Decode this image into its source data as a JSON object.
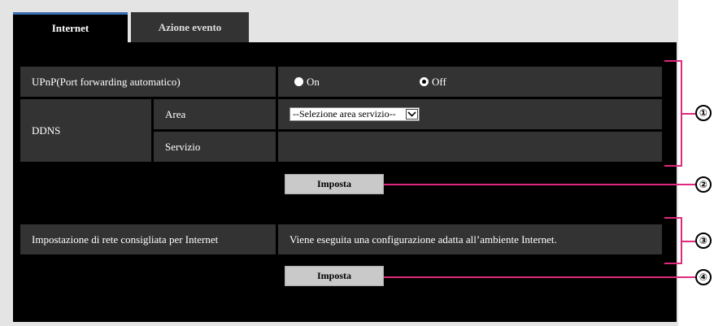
{
  "tabs": [
    {
      "label": "Internet"
    },
    {
      "label": "Azione evento"
    }
  ],
  "upnp": {
    "label": "UPnP(Port forwarding automatico)",
    "option_on": "On",
    "option_off": "Off",
    "selected": "Off"
  },
  "ddns": {
    "label": "DDNS",
    "area_label": "Area",
    "area_value": "--Selezione area servizio--",
    "servizio_label": "Servizio",
    "servizio_value": ""
  },
  "buttons": {
    "imposta_1": "Imposta",
    "imposta_2": "Imposta"
  },
  "network": {
    "label": "Impostazione di rete consigliata per Internet",
    "description": "Viene eseguita una configurazione adatta all’ambiente Internet."
  },
  "callouts": [
    "①",
    "②",
    "③",
    "④"
  ],
  "colors": {
    "accent_line": "#e0287d",
    "tab_active_border": "#3b6fb0",
    "panel_bg": "#000000",
    "cell_bg": "#333333"
  }
}
